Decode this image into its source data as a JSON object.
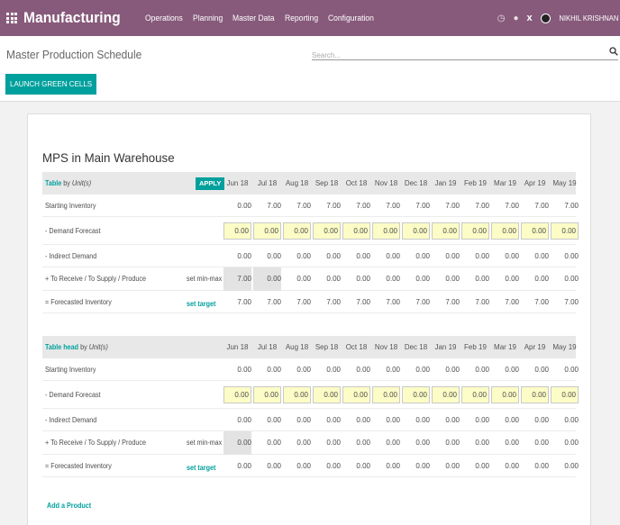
{
  "navbar": {
    "brand": "Manufacturing",
    "menu": [
      "Operations",
      "Planning",
      "Master Data",
      "Reporting",
      "Configuration"
    ],
    "user_name": "NIKHIL KRISHNAN",
    "close_label": "x"
  },
  "control": {
    "page_title": "Master Production Schedule",
    "search_placeholder": "Search...",
    "launch_label": "LAUNCH GREEN CELLS"
  },
  "mps": {
    "title": "MPS in Main Warehouse",
    "months": [
      "Jun 18",
      "Jul 18",
      "Aug 18",
      "Sep 18",
      "Oct 18",
      "Nov 18",
      "Dec 18",
      "Jan 19",
      "Feb 19",
      "Mar 19",
      "Apr 19",
      "May 19"
    ],
    "apply_label": "APPLY",
    "row_labels": {
      "starting": "Starting Inventory",
      "demand": "- Demand Forecast",
      "indirect": "- Indirect Demand",
      "receive": "+ To Receive / To Supply / Produce",
      "forecasted": "= Forecasted Inventory"
    },
    "set_min_max": "set min-max",
    "set_target": "set target",
    "add_product": "Add a Product",
    "products": [
      {
        "name": "Table",
        "unit_prefix": "by",
        "unit": "Unit(s)",
        "starting": [
          "0.00",
          "7.00",
          "7.00",
          "7.00",
          "7.00",
          "7.00",
          "7.00",
          "7.00",
          "7.00",
          "7.00",
          "7.00",
          "7.00"
        ],
        "demand": [
          "0.00",
          "0.00",
          "0.00",
          "0.00",
          "0.00",
          "0.00",
          "0.00",
          "0.00",
          "0.00",
          "0.00",
          "0.00",
          "0.00"
        ],
        "indirect": [
          "0.00",
          "0.00",
          "0.00",
          "0.00",
          "0.00",
          "0.00",
          "0.00",
          "0.00",
          "0.00",
          "0.00",
          "0.00",
          "0.00"
        ],
        "receive": [
          "7.00",
          "0.00",
          "0.00",
          "0.00",
          "0.00",
          "0.00",
          "0.00",
          "0.00",
          "0.00",
          "0.00",
          "0.00",
          "0.00"
        ],
        "forecasted": [
          "7.00",
          "7.00",
          "7.00",
          "7.00",
          "7.00",
          "7.00",
          "7.00",
          "7.00",
          "7.00",
          "7.00",
          "7.00",
          "7.00"
        ]
      },
      {
        "name": "Table head",
        "unit_prefix": "by",
        "unit": "Unit(s)",
        "starting": [
          "0.00",
          "0.00",
          "0.00",
          "0.00",
          "0.00",
          "0.00",
          "0.00",
          "0.00",
          "0.00",
          "0.00",
          "0.00",
          "0.00"
        ],
        "demand": [
          "0.00",
          "0.00",
          "0.00",
          "0.00",
          "0.00",
          "0.00",
          "0.00",
          "0.00",
          "0.00",
          "0.00",
          "0.00",
          "0.00"
        ],
        "indirect": [
          "0.00",
          "0.00",
          "0.00",
          "0.00",
          "0.00",
          "0.00",
          "0.00",
          "0.00",
          "0.00",
          "0.00",
          "0.00",
          "0.00"
        ],
        "receive": [
          "0.00",
          "0.00",
          "0.00",
          "0.00",
          "0.00",
          "0.00",
          "0.00",
          "0.00",
          "0.00",
          "0.00",
          "0.00",
          "0.00"
        ],
        "forecasted": [
          "0.00",
          "0.00",
          "0.00",
          "0.00",
          "0.00",
          "0.00",
          "0.00",
          "0.00",
          "0.00",
          "0.00",
          "0.00",
          "0.00"
        ]
      }
    ]
  }
}
